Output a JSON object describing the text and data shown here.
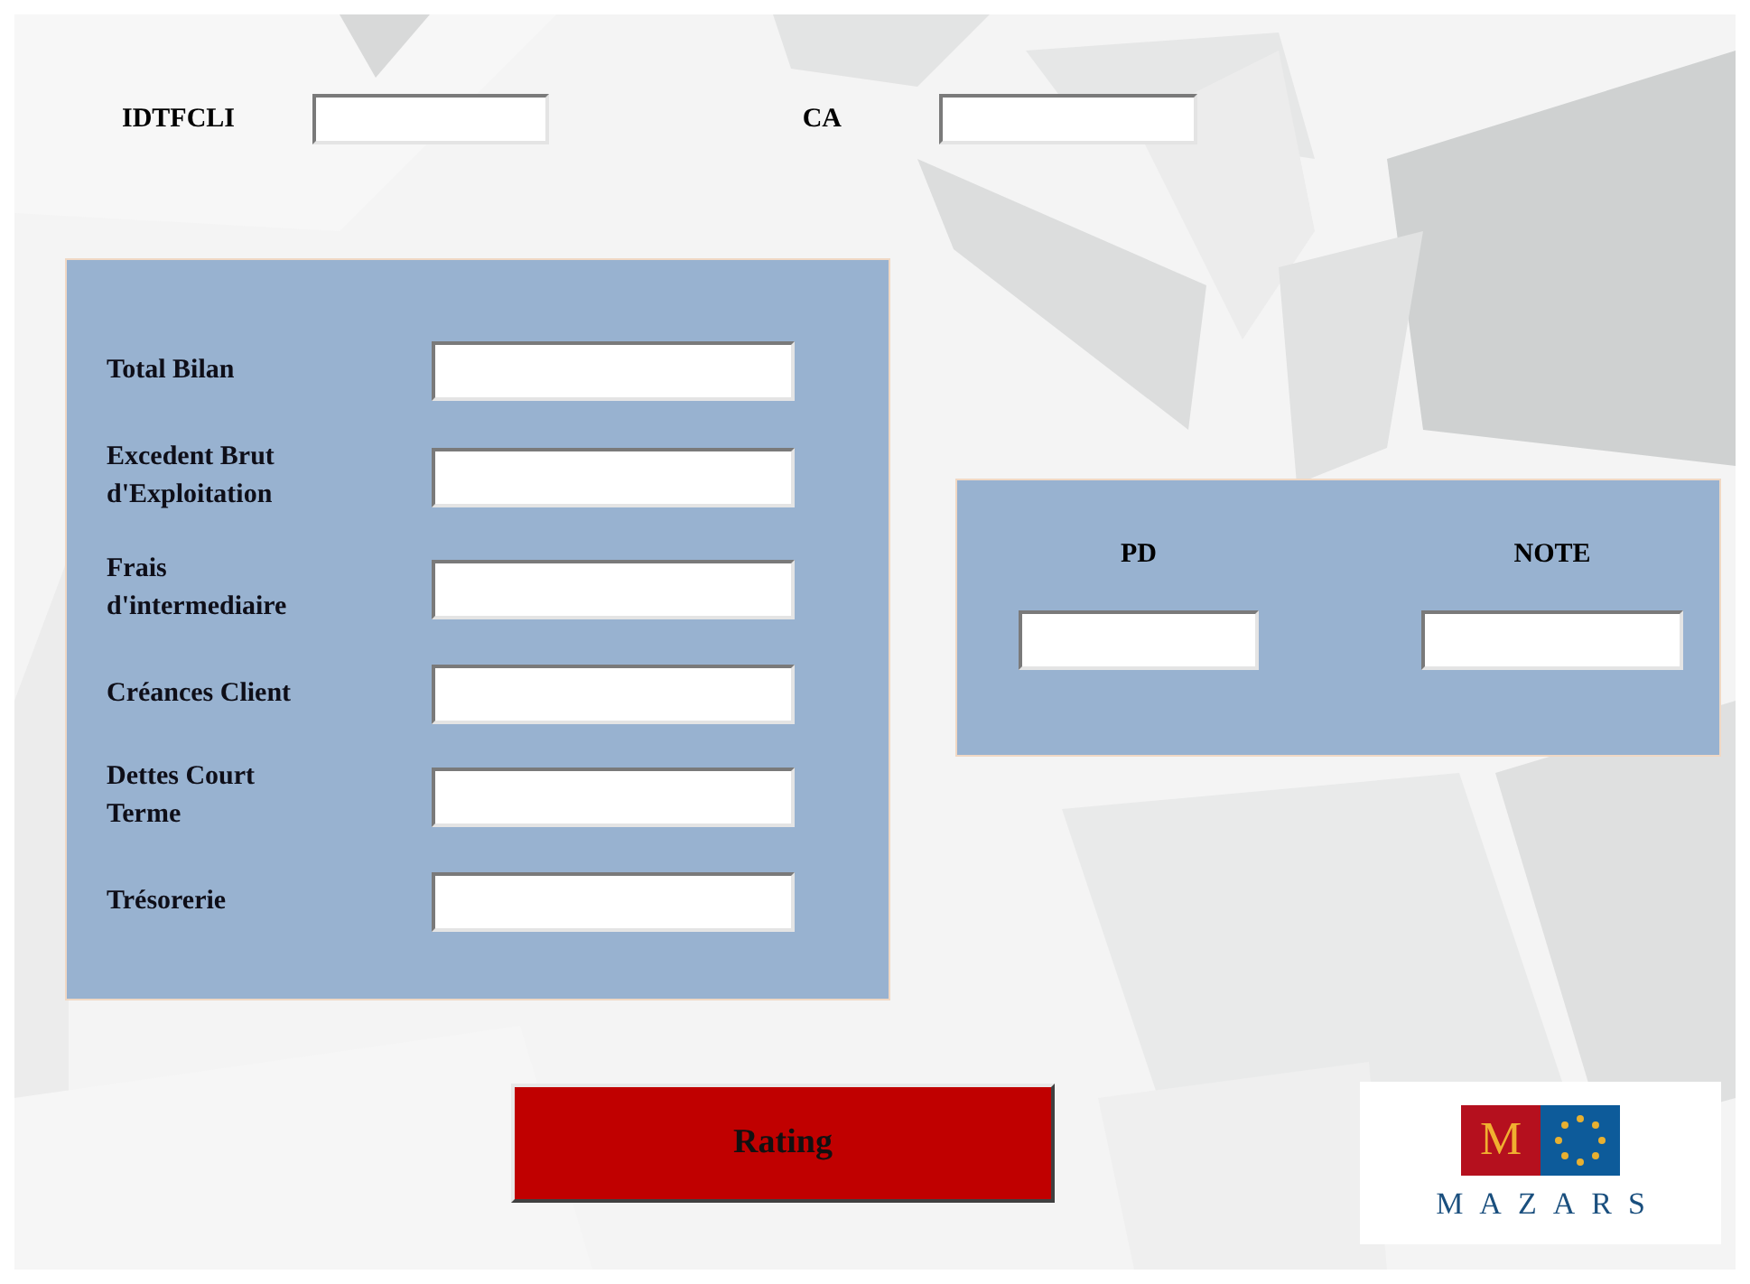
{
  "header_fields": [
    {
      "label": "IDTFCLI"
    },
    {
      "label": "CA"
    }
  ],
  "financial_fields": [
    {
      "label": "Total Bilan"
    },
    {
      "label": "Excedent Brut\nd'Exploitation"
    },
    {
      "label": "Frais\nd'intermediaire"
    },
    {
      "label": "Créances Client"
    },
    {
      "label": "Dettes Court\nTerme"
    },
    {
      "label": "Trésorerie"
    }
  ],
  "result_fields": [
    {
      "label": "PD"
    },
    {
      "label": "NOTE"
    }
  ],
  "rating_button": {
    "label": "Rating"
  },
  "logo": {
    "mark": "M",
    "name": "MAZARS"
  }
}
